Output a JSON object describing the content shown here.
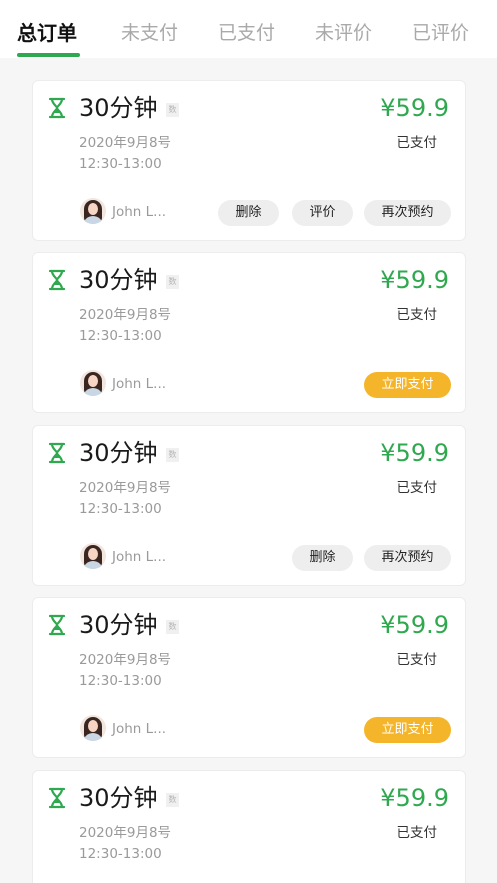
{
  "tabs": [
    {
      "label": "总订单"
    },
    {
      "label": "未支付"
    },
    {
      "label": "已支付"
    },
    {
      "label": "未评价"
    },
    {
      "label": "已评价"
    }
  ],
  "colors": {
    "accent": "#2fa84f",
    "pay_button": "#f5b52a"
  },
  "orders": [
    {
      "title": "30分钟",
      "tag": "数",
      "date": "2020年9月8号",
      "time": "12:30-13:00",
      "price": "¥59.9",
      "status": "已支付",
      "user": "John L...",
      "buttons": [
        "删除",
        "评价",
        "再次预约"
      ]
    },
    {
      "title": "30分钟",
      "tag": "数",
      "date": "2020年9月8号",
      "time": "12:30-13:00",
      "price": "¥59.9",
      "status": "已支付",
      "user": "John L...",
      "buttons": [
        "立即支付"
      ]
    },
    {
      "title": "30分钟",
      "tag": "数",
      "date": "2020年9月8号",
      "time": "12:30-13:00",
      "price": "¥59.9",
      "status": "已支付",
      "user": "John L...",
      "buttons": [
        "删除",
        "再次预约"
      ]
    },
    {
      "title": "30分钟",
      "tag": "数",
      "date": "2020年9月8号",
      "time": "12:30-13:00",
      "price": "¥59.9",
      "status": "已支付",
      "user": "John L...",
      "buttons": [
        "立即支付"
      ]
    },
    {
      "title": "30分钟",
      "tag": "数",
      "date": "2020年9月8号",
      "time": "12:30-13:00",
      "price": "¥59.9",
      "status": "已支付",
      "user": "",
      "buttons": []
    }
  ]
}
